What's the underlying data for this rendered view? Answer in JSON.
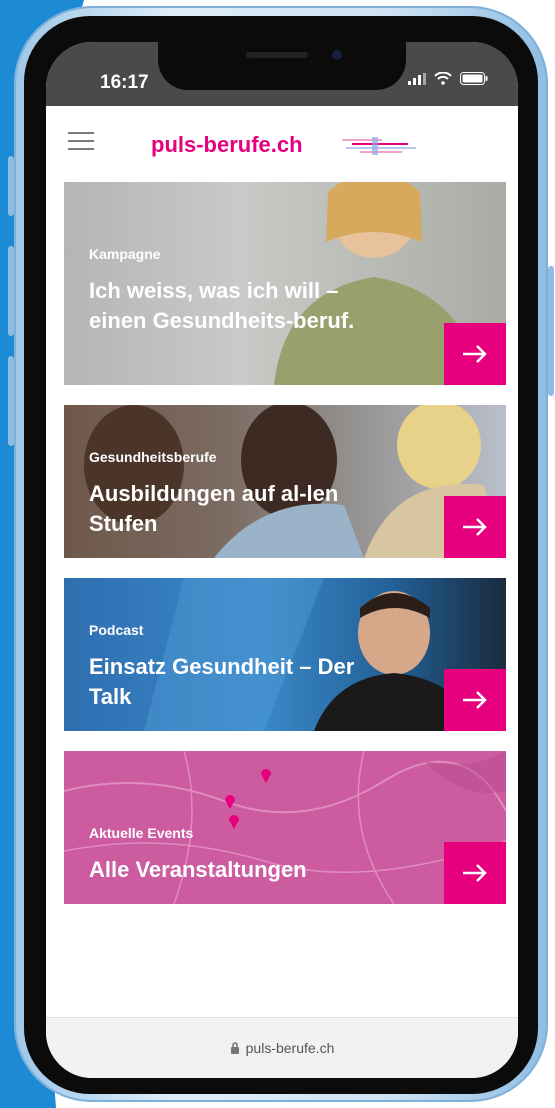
{
  "status": {
    "time": "16:17"
  },
  "header": {
    "logo_text": "puls-berufe.ch"
  },
  "cards": [
    {
      "eyebrow": "Kampagne",
      "title": "Ich weiss, was ich will – einen Gesundheits-beruf.",
      "arrow": "→"
    },
    {
      "eyebrow": "Gesundheitsberufe",
      "title": "Ausbildungen auf al-len Stufen",
      "arrow": "→"
    },
    {
      "eyebrow": "Podcast",
      "title": "Einsatz Gesundheit – Der Talk",
      "arrow": "→"
    },
    {
      "eyebrow": "Aktuelle Events",
      "title": "Alle Veranstaltungen",
      "arrow": "→"
    }
  ],
  "urlbar": {
    "url": "puls-berufe.ch"
  },
  "colors": {
    "brand": "#e6007e",
    "events_bg": "#cc5ba0",
    "podcast_bg": "#3a88c8"
  }
}
